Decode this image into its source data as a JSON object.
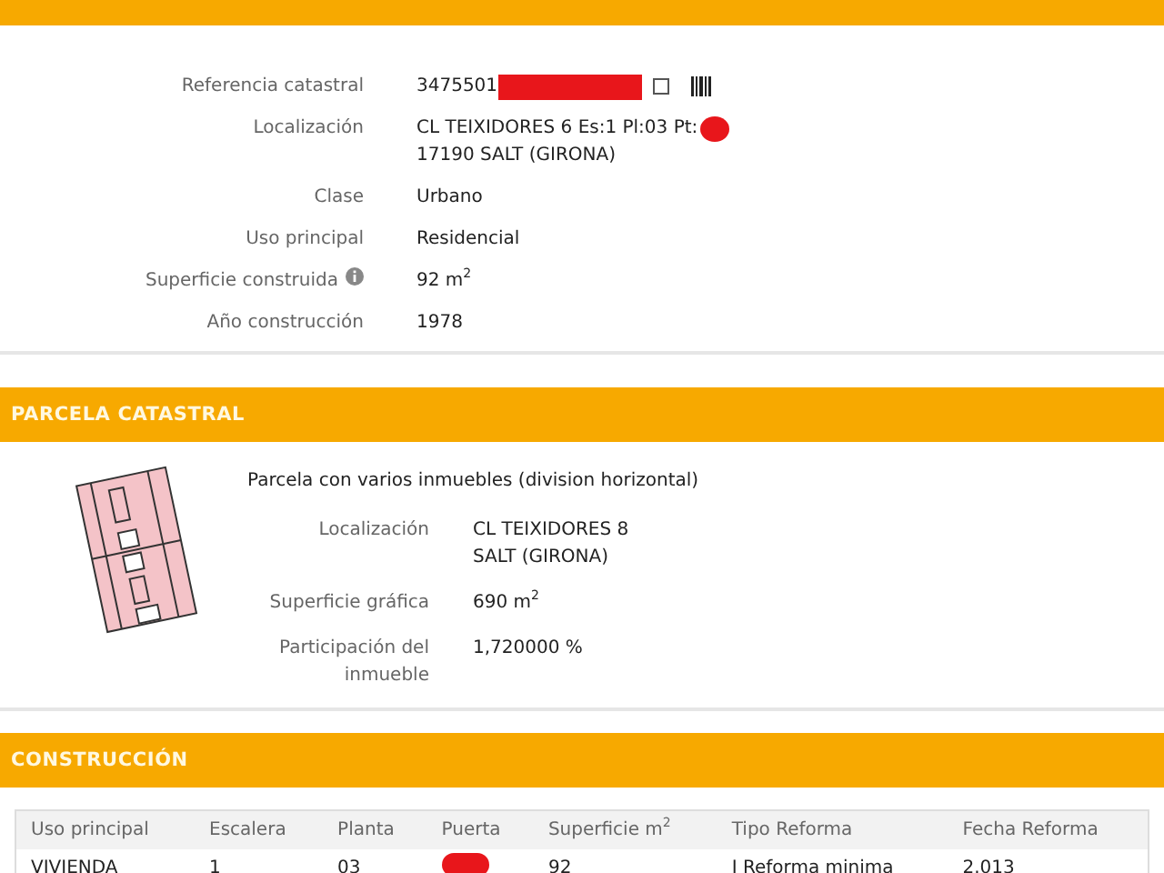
{
  "sections": [
    {
      "kind": "details",
      "rows": [
        {
          "kind": "reference",
          "label": "Referencia catastral",
          "lines": [
            "3475501"
          ]
        },
        {
          "kind": "location",
          "label": "Localización",
          "lines": [
            "CL TEIXIDORES 6 Es:1 Pl:03 Pt:",
            "17190 SALT (GIRONA)"
          ]
        },
        {
          "kind": "plain",
          "label": "Clase",
          "lines": [
            "Urbano"
          ]
        },
        {
          "kind": "plain",
          "label": "Uso principal",
          "lines": [
            "Residencial"
          ]
        },
        {
          "kind": "info",
          "label": "Superficie construida",
          "lines": [
            "92 m$^{2}$"
          ]
        },
        {
          "kind": "plain",
          "label": "Año construcción",
          "lines": [
            "1978"
          ]
        }
      ]
    },
    {
      "kind": "parcel",
      "title": "PARCELA CATASTRAL",
      "heading": "Parcela con varios inmuebles (division horizontal)",
      "rows": [
        {
          "label": "Localización",
          "lines": [
            "CL TEIXIDORES 8",
            "SALT (GIRONA)"
          ]
        },
        {
          "label": "Superficie gráfica",
          "lines": [
            "690 m$^{2}$"
          ]
        },
        {
          "label": "Participación del inmueble",
          "lines": [
            "1,720000 %"
          ]
        }
      ]
    },
    {
      "kind": "table",
      "title": "CONSTRUCCIÓN",
      "columns": [
        "Uso principal",
        "Escalera",
        "Planta",
        "Puerta",
        "Superficie m$^{2}$",
        "Tipo Reforma",
        "Fecha Reforma"
      ],
      "rows": [
        [
          "VIVIENDA",
          "1",
          "03",
          null,
          "92",
          "I Reforma minima",
          "2.013"
        ]
      ]
    }
  ]
}
